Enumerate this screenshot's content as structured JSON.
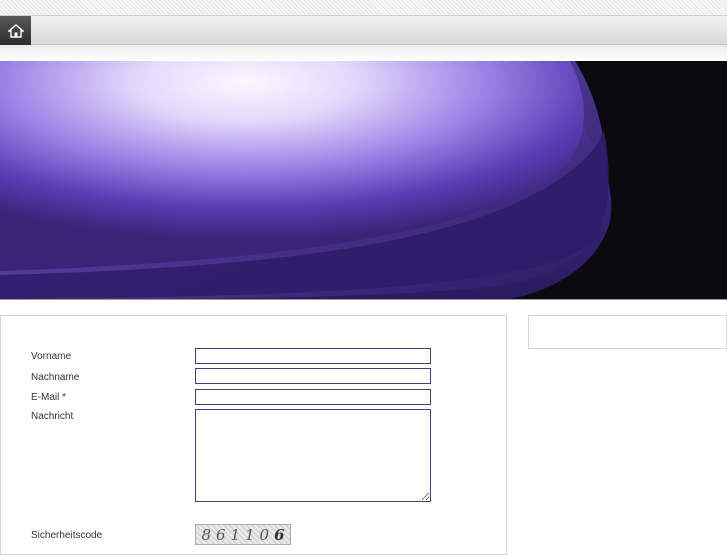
{
  "nav": {
    "home_icon": "home-icon"
  },
  "hero": {
    "description_colors": [
      "#d9ccf5",
      "#6a48c8",
      "#2a1a5e",
      "#0a0a0a"
    ]
  },
  "form": {
    "fields": [
      {
        "label": "Vorname",
        "value": ""
      },
      {
        "label": "Nachname",
        "value": ""
      },
      {
        "label": "E-Mail *",
        "value": ""
      },
      {
        "label": "Nachricht",
        "value": ""
      }
    ],
    "captcha": {
      "label": "Sicherheitscode",
      "code": [
        "8",
        "6",
        "1",
        "1",
        "0",
        "6"
      ]
    }
  },
  "colors": {
    "input_border": "#4a3a80",
    "nav_button": "#3a3a3a"
  }
}
